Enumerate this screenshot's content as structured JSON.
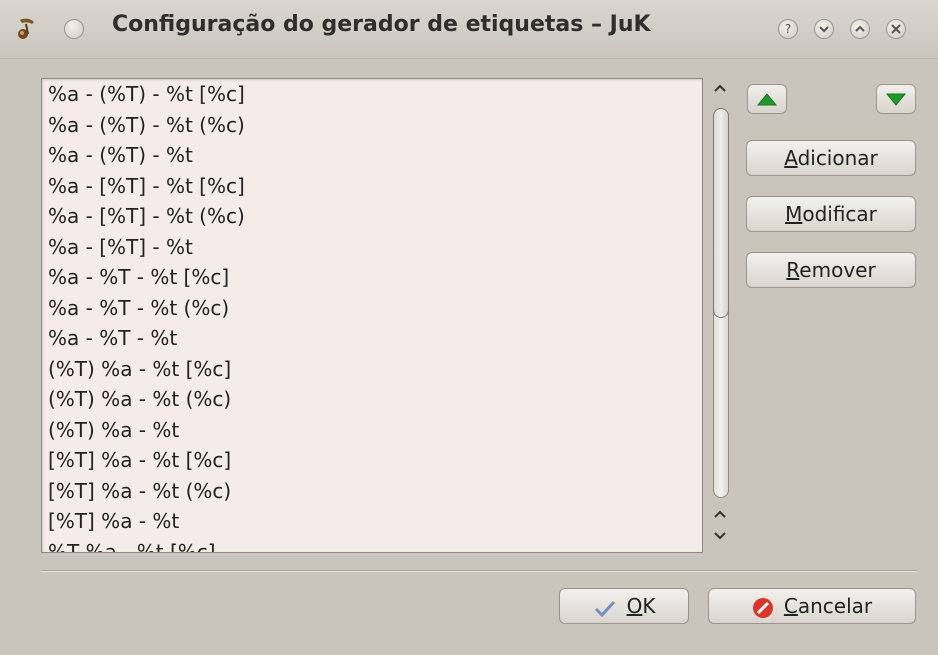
{
  "window": {
    "title": "Configuração do gerador de etiquetas – JuK"
  },
  "list": {
    "items": [
      "%a - (%T) - %t [%c]",
      "%a - (%T) - %t (%c)",
      "%a - (%T) - %t",
      "%a - [%T] - %t [%c]",
      "%a - [%T] - %t (%c)",
      "%a - [%T] - %t",
      "%a - %T - %t [%c]",
      "%a - %T - %t (%c)",
      "%a - %T - %t",
      "(%T) %a - %t [%c]",
      "(%T) %a - %t (%c)",
      "(%T) %a - %t",
      "[%T] %a - %t [%c]",
      "[%T] %a - %t (%c)",
      "[%T] %a - %t",
      "%T %a - %t [%c]"
    ]
  },
  "buttons": {
    "add": {
      "mnemonic": "A",
      "rest": "dicionar"
    },
    "modify": {
      "mnemonic": "M",
      "rest": "odificar"
    },
    "remove": {
      "mnemonic": "R",
      "rest": "emover"
    },
    "ok": {
      "mnemonic": "O",
      "rest": "K"
    },
    "cancel": {
      "mnemonic": "C",
      "rest": "ancelar"
    }
  },
  "colors": {
    "accent_green": "#1f9a2a",
    "cancel_red": "#d9372b",
    "ok_blue": "#6f8fc6"
  },
  "icons": {
    "app": "juk-app-icon",
    "move_up": "triangle-up-icon",
    "move_down": "triangle-down-icon",
    "ok": "checkmark-icon",
    "cancel": "cancel-icon"
  }
}
